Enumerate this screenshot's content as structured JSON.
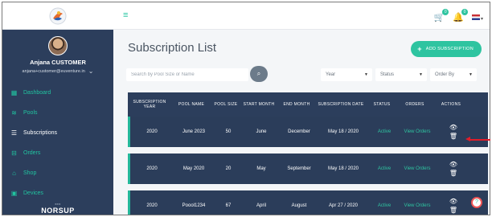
{
  "sidebar": {
    "user_name": "Anjana CUSTOMER",
    "user_email": "anjana+customer@euventure.in",
    "items": [
      {
        "label": "Dashboard",
        "icon": "dashboard-icon"
      },
      {
        "label": "Pools",
        "icon": "pool-icon"
      },
      {
        "label": "Subscriptions",
        "icon": "subscriptions-icon"
      },
      {
        "label": "Orders",
        "icon": "orders-icon"
      },
      {
        "label": "Shop",
        "icon": "shop-icon"
      },
      {
        "label": "Devices",
        "icon": "devices-icon"
      }
    ],
    "brand": "NORSUP"
  },
  "topbar": {
    "cart_badge": "0",
    "notification_badge": "0"
  },
  "main": {
    "title": "Subscription List",
    "add_button": "ADD SUBSCRIPTION",
    "search_placeholder": "Search by Pool Size or Name",
    "filters": {
      "year": "Year",
      "status": "Status",
      "order_by": "Order By"
    }
  },
  "table": {
    "headers": {
      "year": "SUBSCRIPTION YEAR",
      "pool_name": "POOL NAME",
      "pool_size": "POOL SIZE",
      "start_month": "START MONTH",
      "end_month": "END MONTH",
      "sub_date": "SUBSCRIPTION DATE",
      "status": "STATUS",
      "orders": "ORDERS",
      "actions": "ACTIONS"
    },
    "rows": [
      {
        "year": "2020",
        "pool_name": "June 2023",
        "pool_size": "50",
        "start_month": "June",
        "end_month": "December",
        "sub_date": "May 18 / 2020",
        "status": "Active",
        "orders": "View Orders"
      },
      {
        "year": "2020",
        "pool_name": "May 2020",
        "pool_size": "20",
        "start_month": "May",
        "end_month": "September",
        "sub_date": "May 18 / 2020",
        "status": "Active",
        "orders": "View Orders"
      },
      {
        "year": "2020",
        "pool_name": "Poool1234",
        "pool_size": "67",
        "start_month": "April",
        "end_month": "August",
        "sub_date": "Apr 27 / 2020",
        "status": "Active",
        "orders": "View Orders"
      }
    ]
  },
  "colors": {
    "accent": "#2ec4a0",
    "sidebar": "#2c3e5c",
    "annotation": "#e11d2a"
  }
}
